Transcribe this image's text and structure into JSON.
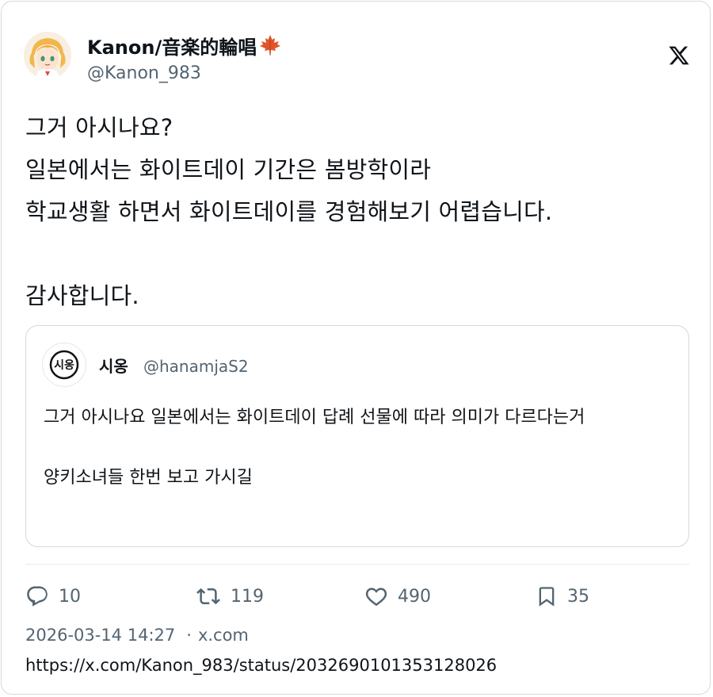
{
  "author": {
    "name": "Kanon/音楽的輪唱",
    "handle": "@Kanon_983"
  },
  "tweet": {
    "text": "그거 아시나요?\n일본에서는 화이트데이 기간은 봄방학이라\n학교생활 하면서 화이트데이를 경험해보기 어렵습니다.\n\n감사합니다."
  },
  "quoted_tweet": {
    "name": "시옹",
    "handle": "@hanamjaS2",
    "avatar_text": "시옹",
    "text": "그거 아시나요 일본에서는 화이트데이 답례 선물에 따라 의미가 다르다는거\n\n양키소녀들 한번 보고 가시길"
  },
  "stats": {
    "replies": "10",
    "retweets": "119",
    "likes": "490",
    "bookmarks": "35"
  },
  "meta": {
    "timestamp": "2026-03-14 14:27",
    "separator": "·",
    "source": "x.com",
    "url": "https://x.com/Kanon_983/status/2032690101353128026"
  },
  "icons": {
    "logo": "x-logo-icon",
    "maple": "maple-leaf-icon",
    "reply": "reply-icon",
    "retweet": "retweet-icon",
    "like": "heart-icon",
    "bookmark": "bookmark-icon"
  },
  "colors": {
    "text": "#0f1419",
    "secondary": "#536471",
    "border": "#cfd9de",
    "maple": "#e0542a"
  }
}
